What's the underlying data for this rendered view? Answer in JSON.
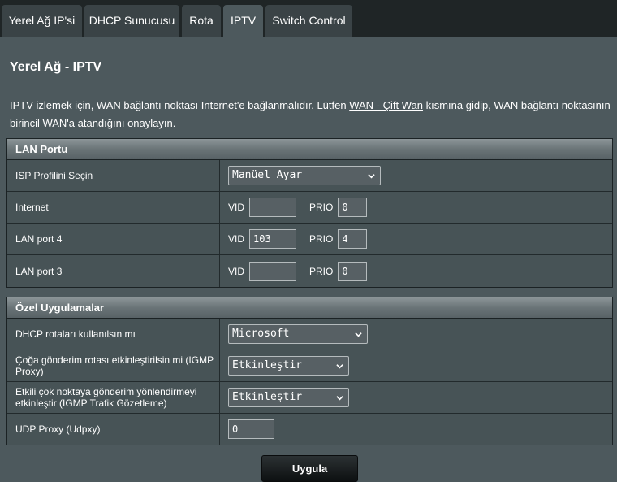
{
  "tabs": [
    {
      "label": "Yerel Ağ IP'si"
    },
    {
      "label": "DHCP Sunucusu"
    },
    {
      "label": "Rota"
    },
    {
      "label": "IPTV"
    },
    {
      "label": "Switch Control"
    }
  ],
  "page": {
    "title": "Yerel Ağ - IPTV",
    "desc_before": "IPTV izlemek için, WAN bağlantı noktası Internet'e bağlanmalıdır. Lütfen ",
    "desc_link": "WAN - Çift Wan",
    "desc_after": " kısmına gidip, WAN bağlantı noktasının birincil WAN'a atandığını onaylayın."
  },
  "lan_port": {
    "header": "LAN Portu",
    "isp_label": "ISP Profilini Seçin",
    "isp_value": "Manüel Ayar",
    "vid_label": "VID",
    "prio_label": "PRIO",
    "rows": [
      {
        "label": "Internet",
        "vid": "",
        "prio": "0"
      },
      {
        "label": "LAN port 4",
        "vid": "103",
        "prio": "4"
      },
      {
        "label": "LAN port 3",
        "vid": "",
        "prio": "0"
      }
    ]
  },
  "special_apps": {
    "header": "Özel Uygulamalar",
    "dhcp_label": "DHCP rotaları kullanılsın mı",
    "dhcp_value": "Microsoft",
    "igmp_label": "Çoğa gönderim rotası etkinleştirilsin mi (IGMP Proxy)",
    "igmp_value": "Etkinleştir",
    "snooping_label": "Etkili çok noktaya gönderim yönlendirmeyi etkinleştir (IGMP Trafik Gözetleme)",
    "snooping_value": "Etkinleştir",
    "udp_label": "UDP Proxy (Udpxy)",
    "udp_value": "0"
  },
  "apply_label": "Uygula",
  "icons": {
    "select_arrow": "chevron-down-icon"
  },
  "colors": {
    "background": "#1f2526",
    "panel": "#4d595d",
    "tab": "#3a4346"
  }
}
